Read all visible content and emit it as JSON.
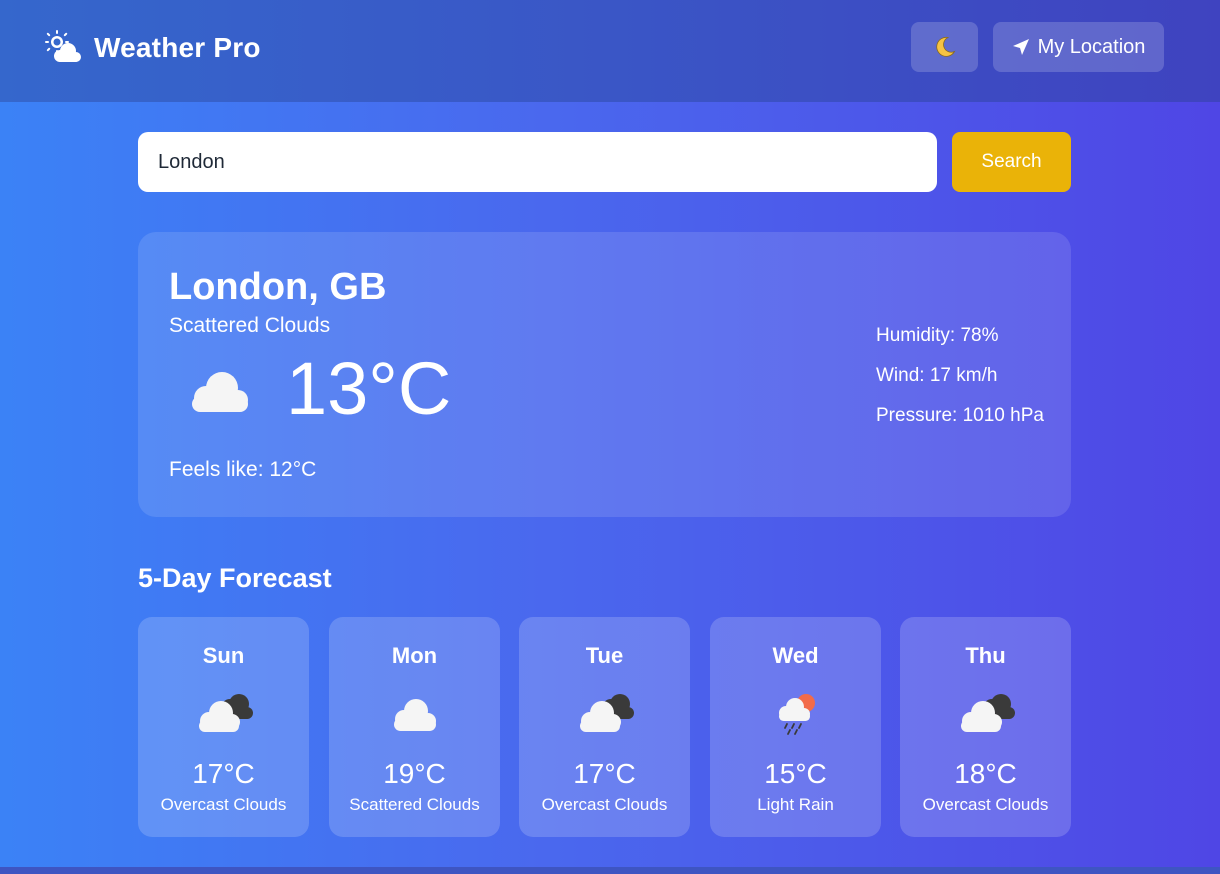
{
  "app": {
    "title": "Weather Pro",
    "brand_icon": "sun-cloud-icon",
    "theme_toggle_icon": "moon-icon",
    "location_button_label": "My Location",
    "location_button_icon": "location-arrow-icon"
  },
  "search": {
    "value": "London",
    "button_label": "Search",
    "button_color": "#eab308"
  },
  "current": {
    "city": "London, GB",
    "condition": "Scattered Clouds",
    "icon": "cloud-icon",
    "temperature": "13°C",
    "feels_like": "Feels like: 12°C",
    "humidity": "Humidity: 78%",
    "wind": "Wind: 17 km/h",
    "pressure": "Pressure: 1010 hPa"
  },
  "forecast": {
    "title": "5-Day Forecast",
    "days": [
      {
        "day": "Sun",
        "temp": "17°C",
        "desc": "Overcast Clouds",
        "icon": "overcast-clouds-icon"
      },
      {
        "day": "Mon",
        "temp": "19°C",
        "desc": "Scattered Clouds",
        "icon": "cloud-icon"
      },
      {
        "day": "Tue",
        "temp": "17°C",
        "desc": "Overcast Clouds",
        "icon": "overcast-clouds-icon"
      },
      {
        "day": "Wed",
        "temp": "15°C",
        "desc": "Light Rain",
        "icon": "rain-cloud-sun-icon"
      },
      {
        "day": "Thu",
        "temp": "18°C",
        "desc": "Overcast Clouds",
        "icon": "overcast-clouds-icon"
      }
    ]
  }
}
